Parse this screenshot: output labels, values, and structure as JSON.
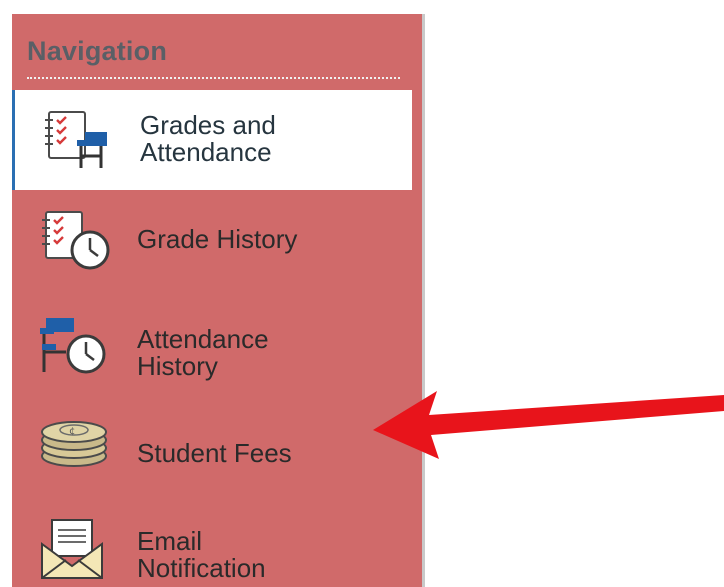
{
  "nav": {
    "title": "Navigation",
    "items": [
      {
        "line1": "Grades and",
        "line2": "Attendance",
        "icon": "grades-attendance-icon",
        "active": true
      },
      {
        "line1": "Grade History",
        "line2": "",
        "icon": "grade-history-icon",
        "active": false
      },
      {
        "line1": "Attendance",
        "line2": "History",
        "icon": "attendance-history-icon",
        "active": false
      },
      {
        "line1": "Student Fees",
        "line2": "",
        "icon": "student-fees-icon",
        "active": false
      },
      {
        "line1": "Email",
        "line2": "Notification",
        "icon": "email-notification-icon",
        "active": false
      }
    ]
  },
  "colors": {
    "panel": "#d06a6a",
    "active_bg": "#ffffff",
    "arrow": "#e8141b",
    "header_text": "#5a5f66"
  },
  "annotation": {
    "arrow_target": "Student Fees",
    "icon": "red-arrow-icon"
  }
}
